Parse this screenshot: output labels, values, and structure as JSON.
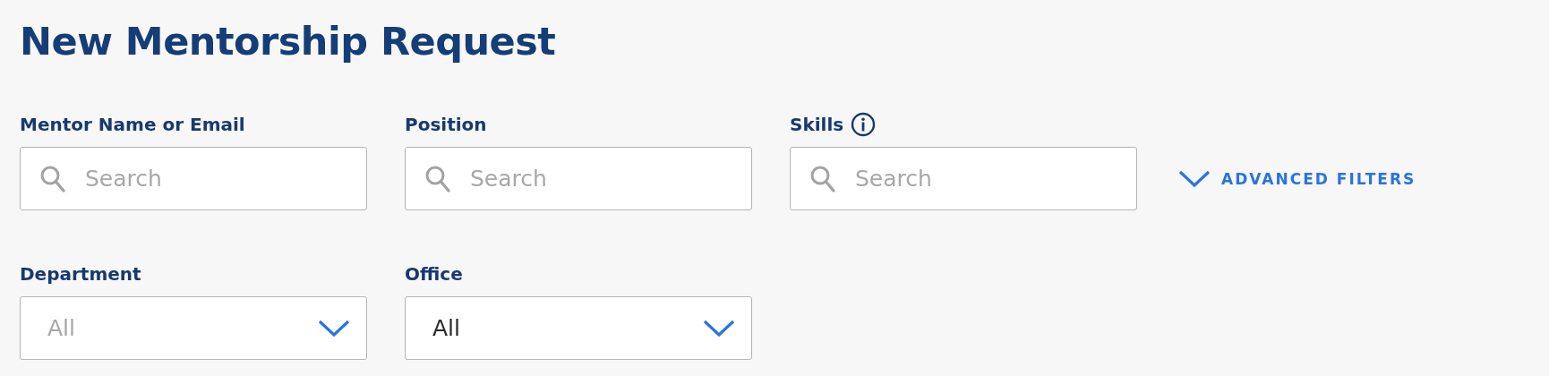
{
  "title": "New Mentorship Request",
  "search_fields": [
    {
      "label": "Mentor Name or Email",
      "placeholder": "Search"
    },
    {
      "label": "Position",
      "placeholder": "Search"
    },
    {
      "label": "Skills",
      "placeholder": "Search",
      "info": true
    }
  ],
  "advanced_filters": {
    "label": "ADVANCED FILTERS",
    "expanded": false
  },
  "dropdowns": [
    {
      "label": "Department",
      "placeholder": "All"
    },
    {
      "label": "Office",
      "value": "All"
    }
  ]
}
